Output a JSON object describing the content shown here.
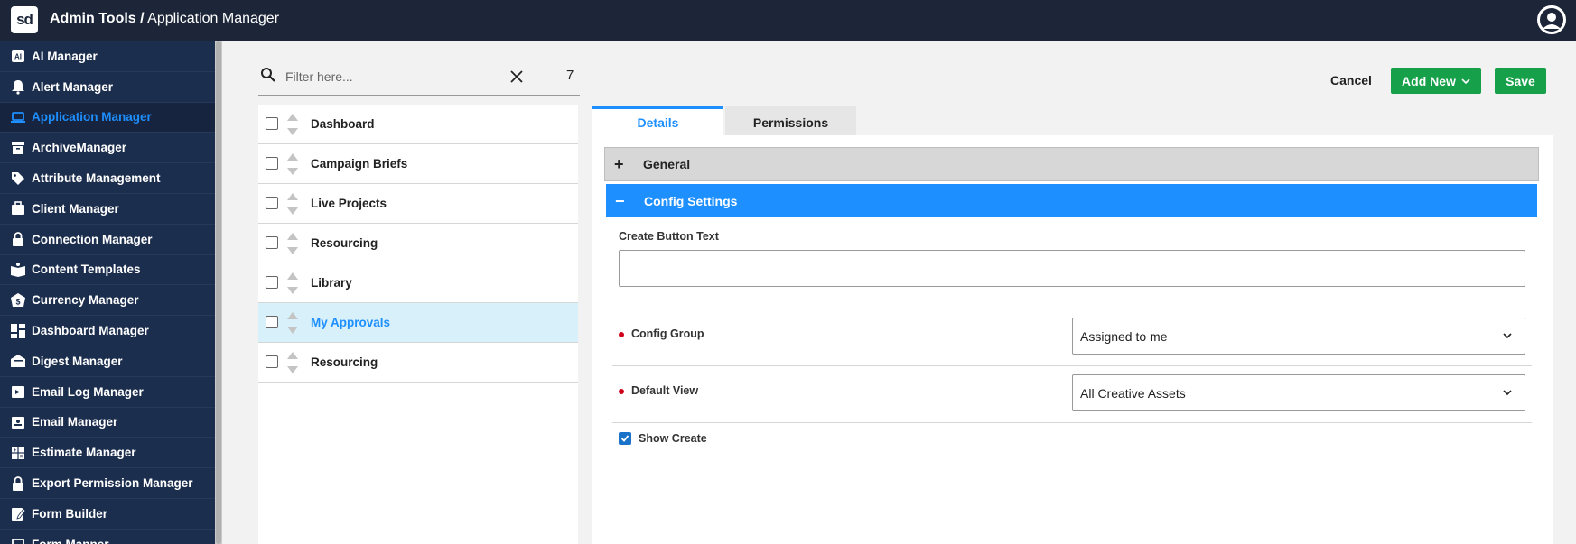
{
  "header": {
    "logo": "sd",
    "section": "Admin Tools /",
    "page": " Application Manager"
  },
  "sidebar": {
    "items": [
      {
        "label": "AI Manager",
        "icon": "ai-icon"
      },
      {
        "label": "Alert Manager",
        "icon": "bell-icon"
      },
      {
        "label": "Application Manager",
        "icon": "laptop-icon",
        "active": true
      },
      {
        "label": "ArchiveManager",
        "icon": "archive-icon"
      },
      {
        "label": "Attribute Management",
        "icon": "tags-icon"
      },
      {
        "label": "Client Manager",
        "icon": "briefcase-icon"
      },
      {
        "label": "Connection Manager",
        "icon": "lock-icon"
      },
      {
        "label": "Content Templates",
        "icon": "book-icon"
      },
      {
        "label": "Currency Manager",
        "icon": "currency-icon"
      },
      {
        "label": "Dashboard Manager",
        "icon": "dashboard-icon"
      },
      {
        "label": "Digest Manager",
        "icon": "digest-icon"
      },
      {
        "label": "Email Log Manager",
        "icon": "email-log-icon"
      },
      {
        "label": "Email Manager",
        "icon": "email-icon"
      },
      {
        "label": "Estimate Manager",
        "icon": "calculator-icon"
      },
      {
        "label": "Export Permission Manager",
        "icon": "lock-icon"
      },
      {
        "label": "Form Builder",
        "icon": "form-icon"
      },
      {
        "label": "Form Mapper",
        "icon": "laptop-icon"
      }
    ]
  },
  "filter": {
    "placeholder": "Filter here...",
    "count": "7"
  },
  "list": {
    "items": [
      {
        "label": "Dashboard"
      },
      {
        "label": "Campaign Briefs"
      },
      {
        "label": "Live Projects"
      },
      {
        "label": "Resourcing"
      },
      {
        "label": "Library"
      },
      {
        "label": "My Approvals",
        "selected": true
      },
      {
        "label": "Resourcing"
      }
    ]
  },
  "toolbar": {
    "cancel_label": "Cancel",
    "add_new_label": "Add New",
    "save_label": "Save"
  },
  "tabs": [
    {
      "label": "Details",
      "active": true
    },
    {
      "label": "Permissions",
      "active": false
    }
  ],
  "accordion": {
    "general": {
      "sign": "+",
      "title": "General"
    },
    "config": {
      "sign": "−",
      "title": "Config Settings"
    }
  },
  "form": {
    "create_button_text": {
      "label": "Create Button Text",
      "value": ""
    },
    "config_group": {
      "label": "Config Group",
      "value": "Assigned to me"
    },
    "default_view": {
      "label": "Default View",
      "value": "All Creative Assets"
    },
    "show_create": {
      "label": "Show Create",
      "checked": true
    }
  },
  "colors": {
    "accent": "#1e8fff",
    "topbar": "#1c2638",
    "sidebar": "#1c2e4d",
    "button_green": "#16a04a",
    "required": "#d0021b"
  }
}
